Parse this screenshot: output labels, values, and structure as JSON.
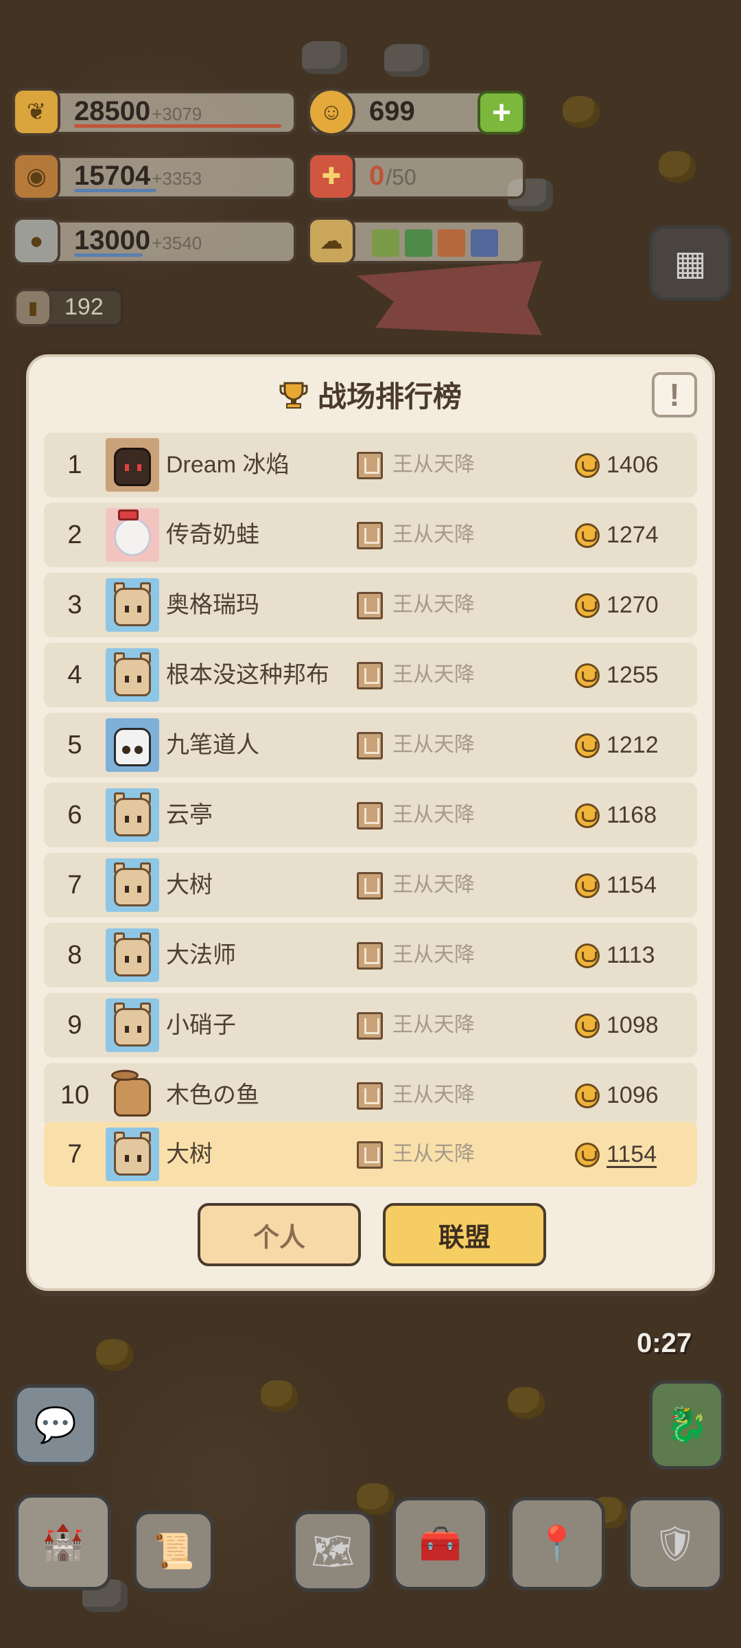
{
  "resources": {
    "food": {
      "value": "28500",
      "increment": "+3079",
      "icon": "grain-icon"
    },
    "wood": {
      "value": "15704",
      "increment": "+3353",
      "icon": "log-icon"
    },
    "stone": {
      "value": "13000",
      "increment": "+3540",
      "icon": "stone-icon"
    },
    "gold": {
      "value": "699",
      "icon": "coin-icon"
    },
    "gifts": {
      "current": "0",
      "max": "/50",
      "icon": "gift-icon"
    },
    "population": {
      "value": "192",
      "icon": "book-icon"
    }
  },
  "modal": {
    "title": "战场排行榜",
    "title_icon": "trophy-icon",
    "info_label": "!",
    "rows": [
      {
        "rank": "1",
        "name": "Dream 冰焰",
        "title": "王从天降",
        "score": "1406"
      },
      {
        "rank": "2",
        "name": "传奇奶蛙",
        "title": "王从天降",
        "score": "1274"
      },
      {
        "rank": "3",
        "name": "奥格瑞玛",
        "title": "王从天降",
        "score": "1270"
      },
      {
        "rank": "4",
        "name": "根本没这种邦布",
        "title": "王从天降",
        "score": "1255"
      },
      {
        "rank": "5",
        "name": "九笔道人",
        "title": "王从天降",
        "score": "1212"
      },
      {
        "rank": "6",
        "name": "云亭",
        "title": "王从天降",
        "score": "1168"
      },
      {
        "rank": "7",
        "name": "大树",
        "title": "王从天降",
        "score": "1154"
      },
      {
        "rank": "8",
        "name": "大法师",
        "title": "王从天降",
        "score": "1113"
      },
      {
        "rank": "9",
        "name": "小硝子",
        "title": "王从天降",
        "score": "1098"
      },
      {
        "rank": "10",
        "name": "木色の鱼",
        "title": "王从天降",
        "score": "1096"
      }
    ],
    "self": {
      "rank": "7",
      "name": "大树",
      "title": "王从天降",
      "score": "1154"
    },
    "tabs": {
      "personal": "个人",
      "alliance": "联盟"
    }
  },
  "hud": {
    "timer": "0:27"
  },
  "colors": {
    "food_bar": "#c0533a",
    "wood_bar": "#5a7fb0",
    "stone_bar": "#5a7fb0",
    "gift_count": "#c0533a",
    "alliance_tab": "#f5cd62",
    "personal_tab": "#f7d9a8",
    "self_row": "#f9e0aa"
  }
}
